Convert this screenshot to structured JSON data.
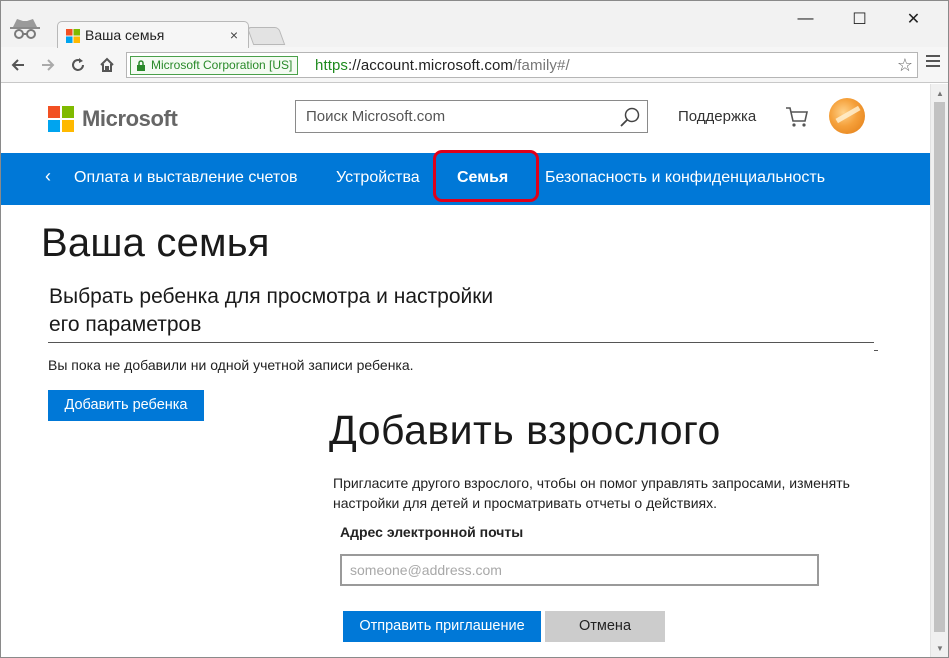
{
  "browser": {
    "tab_title": "Ваша семья",
    "tab_close": "×",
    "window_controls": {
      "minimize": "—",
      "maximize": "☐",
      "close": "✕"
    },
    "ev_badge": "Microsoft Corporation [US]",
    "url_scheme": "https",
    "url_host": "://account.microsoft.com",
    "url_path": "/family#/",
    "icons": [
      "incognito-icon",
      "back-icon",
      "forward-icon",
      "reload-icon",
      "home-icon",
      "lock-icon",
      "star-icon",
      "menu-icon"
    ]
  },
  "header": {
    "logo_text": "Microsoft",
    "search_placeholder": "Поиск Microsoft.com",
    "support_label": "Поддержка",
    "icons": [
      "microsoft-logo-icon",
      "search-icon",
      "cart-icon",
      "avatar"
    ]
  },
  "nav": {
    "back_glyph": "‹",
    "items": [
      {
        "label": "Оплата и выставление счетов",
        "active": false
      },
      {
        "label": "Устройства",
        "active": false
      },
      {
        "label": "Семья",
        "active": true
      },
      {
        "label": "Безопасность и конфиденциальность",
        "active": false
      }
    ]
  },
  "main": {
    "page_title": "Ваша семья",
    "child_section_title_line1": "Выбрать ребенка для просмотра и настройки",
    "child_section_title_line2": "его параметров",
    "no_child_text": "Вы пока не добавили ни одной учетной записи ребенка.",
    "add_child_button": "Добавить ребенка",
    "add_adult_title": "Добавить взрослого",
    "invite_line1": "Пригласите другого взрослого, чтобы он помог управлять запросами, изменять",
    "invite_line2": "настройки для детей и просматривать отчеты о действиях.",
    "email_label": "Адрес электронной почты",
    "email_placeholder": "someone@address.com",
    "email_value": "",
    "send_button": "Отправить приглашение",
    "cancel_button": "Отмена"
  },
  "colors": {
    "accent": "#0078d7",
    "highlight": "#e0001a",
    "ms_red": "#f25022",
    "ms_green": "#7fba00",
    "ms_blue": "#00a4ef",
    "ms_yellow": "#ffb900"
  }
}
